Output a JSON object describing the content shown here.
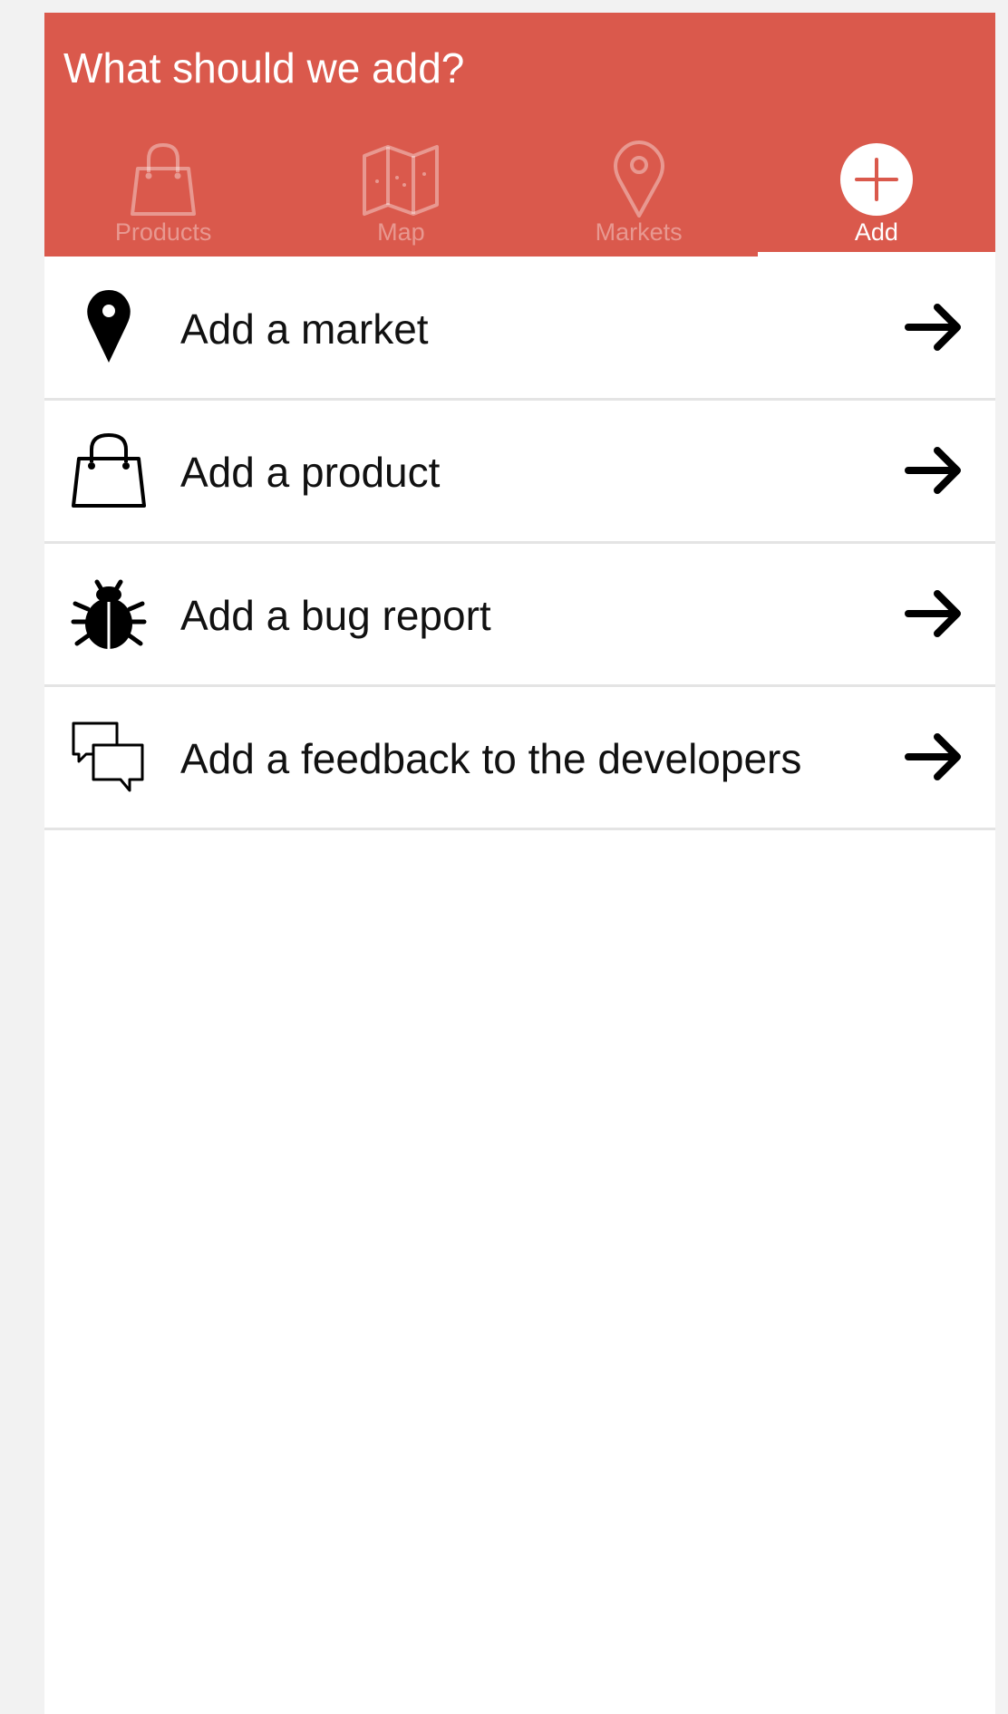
{
  "header": {
    "title": "What should we add?"
  },
  "tabs": [
    {
      "label": "Products",
      "icon": "shopping-bag-icon",
      "active": false
    },
    {
      "label": "Map",
      "icon": "map-icon",
      "active": false
    },
    {
      "label": "Markets",
      "icon": "location-pin-icon",
      "active": false
    },
    {
      "label": "Add",
      "icon": "plus-circle-icon",
      "active": true
    }
  ],
  "list": {
    "items": [
      {
        "label": "Add a market",
        "icon": "map-marker-icon"
      },
      {
        "label": "Add a product",
        "icon": "shopping-bag-icon"
      },
      {
        "label": "Add a bug report",
        "icon": "bug-icon"
      },
      {
        "label": "Add a feedback to the developers",
        "icon": "chat-bubbles-icon"
      }
    ]
  },
  "colors": {
    "header_background": "#da594c",
    "inactive_tab": "rgba(255,255,255,0.38)",
    "active_tab": "#ffffff",
    "divider": "#e4e4e4",
    "page_background": "#f2f2f2"
  }
}
